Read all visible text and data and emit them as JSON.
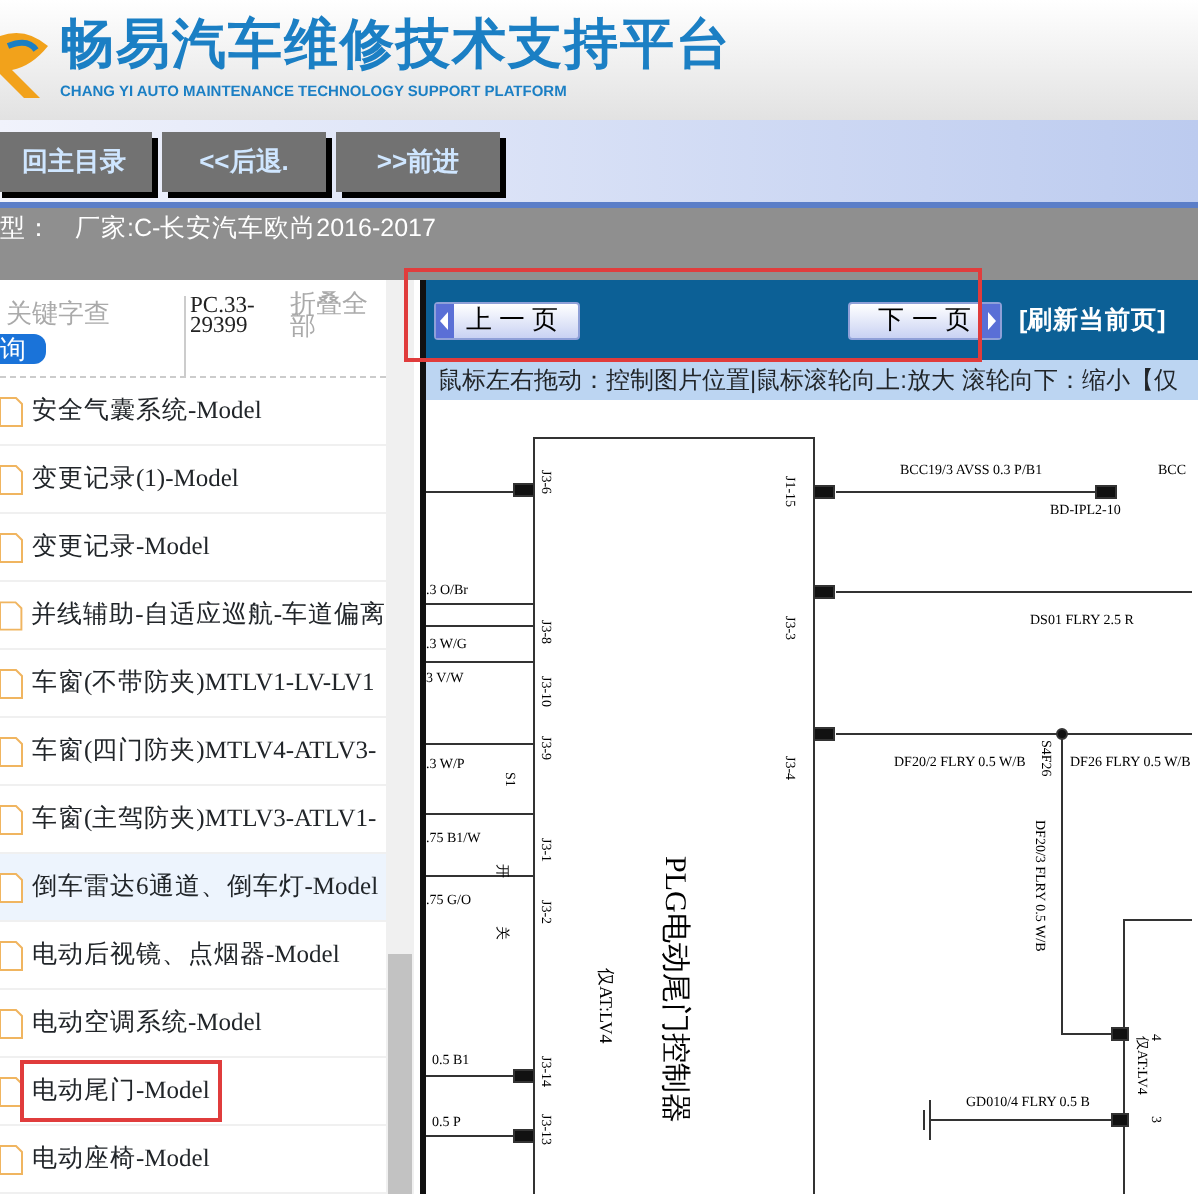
{
  "header": {
    "title": "畅易汽车维修技术支持平台",
    "subtitle": "CHANG YI AUTO MAINTENANCE TECHNOLOGY SUPPORT PLATFORM"
  },
  "nav_buttons": [
    "回主目录",
    "<<后退.",
    ">>前进"
  ],
  "info": {
    "label": "型：",
    "value": "厂家:C-长安汽车欧尚2016-2017"
  },
  "sidebar": {
    "search": {
      "placeholder": "关键字查",
      "button": "询"
    },
    "code": "PC.33-29399",
    "collapse": "折叠全部",
    "items": [
      {
        "label": "安全气囊系统-Model",
        "selected": false,
        "highlighted": false
      },
      {
        "label": "变更记录(1)-Model",
        "selected": false,
        "highlighted": false
      },
      {
        "label": "变更记录-Model",
        "selected": false,
        "highlighted": false
      },
      {
        "label": "并线辅助-自适应巡航-车道偏离",
        "selected": false,
        "highlighted": false
      },
      {
        "label": "车窗(不带防夹)MTLV1-LV-LV1",
        "selected": false,
        "highlighted": false
      },
      {
        "label": "车窗(四门防夹)MTLV4-ATLV3-",
        "selected": false,
        "highlighted": false
      },
      {
        "label": "车窗(主驾防夹)MTLV3-ATLV1-",
        "selected": false,
        "highlighted": false
      },
      {
        "label": "倒车雷达6通道、倒车灯-Model",
        "selected": true,
        "highlighted": false
      },
      {
        "label": "电动后视镜、点烟器-Model",
        "selected": false,
        "highlighted": false
      },
      {
        "label": "电动空调系统-Model",
        "selected": false,
        "highlighted": false
      },
      {
        "label": "电动尾门-Model",
        "selected": false,
        "highlighted": true
      },
      {
        "label": "电动座椅-Model",
        "selected": false,
        "highlighted": false
      }
    ]
  },
  "viewer": {
    "prev": "上 一 页",
    "next": "下 一 页",
    "refresh": "[刷新当前页]",
    "toolbar_highlighted": true,
    "hint": "鼠标左右拖动：控制图片位置|鼠标滚轮向上:放大  滚轮向下：缩小【仅",
    "diagram_labels": [
      {
        "text": "BCC19/3 AVSS 0.3 P/B1"
      },
      {
        "text": "BD-IPL2-10"
      },
      {
        "text": "BCC"
      },
      {
        "text": "DS01 FLRY 2.5 R"
      },
      {
        "text": "DF20/2 FLRY 0.5 W/B"
      },
      {
        "text": "DF26 FLRY 0.5 W/B"
      },
      {
        "text": "S4F26"
      },
      {
        "text": "DF20/3 FLRY 0.5 W/B"
      },
      {
        "text": "GD010/4 FLRY 0.5 B"
      },
      {
        "text": "4"
      },
      {
        "text": "3"
      },
      {
        "text": "仅AT:LV4"
      },
      {
        "text": ".3 O/Br"
      },
      {
        "text": ".3 W/G"
      },
      {
        "text": "3 V/W"
      },
      {
        "text": ".3 W/P"
      },
      {
        "text": ".75 B1/W"
      },
      {
        "text": ".75 G/O"
      },
      {
        "text": "0.5 B1"
      },
      {
        "text": "0.5 P"
      },
      {
        "text": "J3-6"
      },
      {
        "text": "J3-8"
      },
      {
        "text": "J3-10"
      },
      {
        "text": "J3-9"
      },
      {
        "text": "J3-1"
      },
      {
        "text": "J3-2"
      },
      {
        "text": "J3-14"
      },
      {
        "text": "J3-13"
      },
      {
        "text": "J1-15"
      },
      {
        "text": "J3-3"
      },
      {
        "text": "J3-4"
      },
      {
        "text": "S1"
      },
      {
        "text": "开"
      },
      {
        "text": "关"
      },
      {
        "text": "PLG电动尾门控制器"
      },
      {
        "text": "仅AT:LV4"
      }
    ]
  }
}
